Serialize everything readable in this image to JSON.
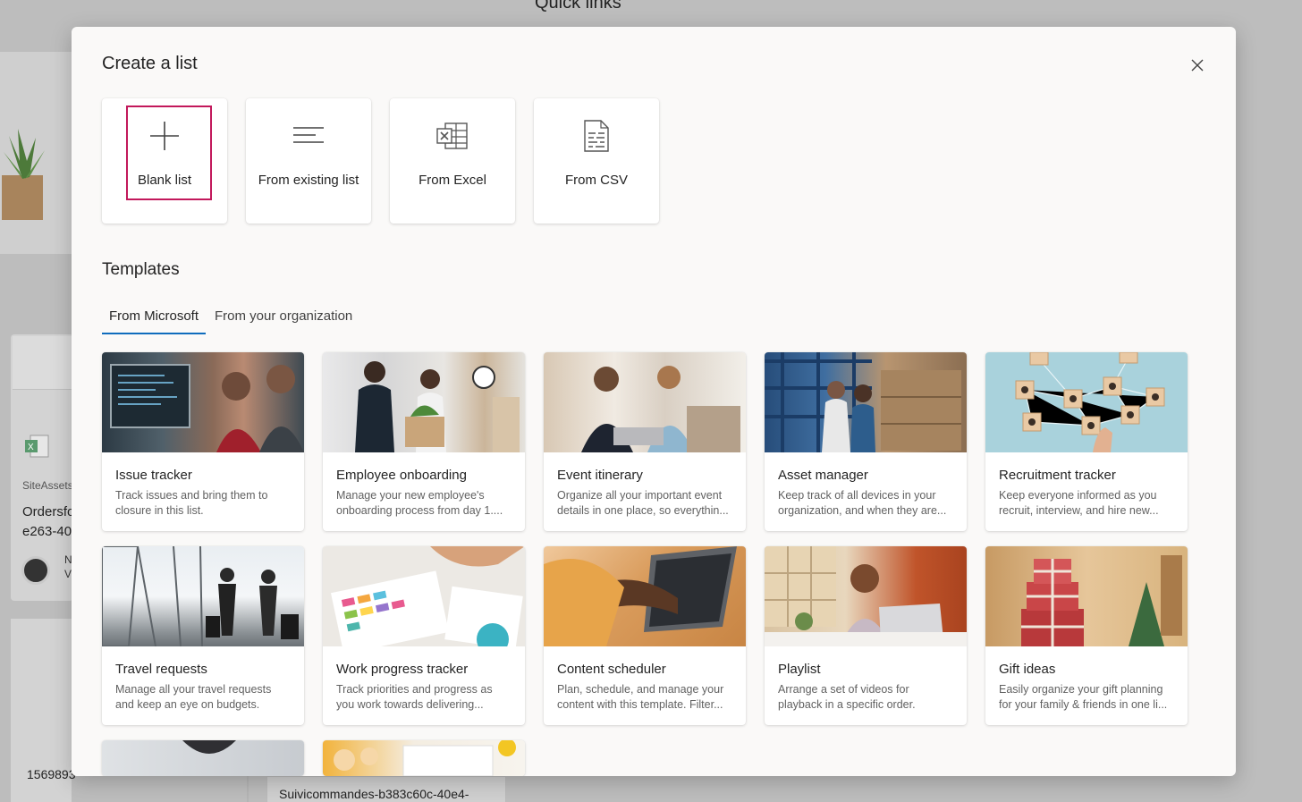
{
  "background": {
    "page_title": "Quick links",
    "site_label": "SiteAssets",
    "file_name_line1": "Ordersfo",
    "file_name_line2": "e263-40",
    "author_initials_1": "N",
    "author_initials_2": "V",
    "number": "1569893",
    "file_name_bottom": "Suivicommandes-b383c60c-40e4-"
  },
  "dialog": {
    "title": "Create a list",
    "close_icon": "close-icon",
    "create_options": [
      {
        "label": "Blank list",
        "icon": "plus-icon",
        "selected": true
      },
      {
        "label": "From existing list",
        "icon": "lines-icon"
      },
      {
        "label": "From Excel",
        "icon": "excel-icon"
      },
      {
        "label": "From CSV",
        "icon": "csv-file-icon"
      }
    ],
    "templates_heading": "Templates",
    "tabs": [
      {
        "label": "From Microsoft",
        "active": true
      },
      {
        "label": "From your organization",
        "active": false
      }
    ],
    "templates": [
      {
        "title": "Issue tracker",
        "desc": "Track issues and bring them to closure in this list."
      },
      {
        "title": "Employee onboarding",
        "desc": "Manage your new employee's onboarding process from day 1...."
      },
      {
        "title": "Event itinerary",
        "desc": "Organize all your important event details in one place, so everythin..."
      },
      {
        "title": "Asset manager",
        "desc": "Keep track of all devices in your organization, and when they are..."
      },
      {
        "title": "Recruitment tracker",
        "desc": "Keep everyone informed as you recruit, interview, and hire new..."
      },
      {
        "title": "Travel requests",
        "desc": "Manage all your travel requests and keep an eye on budgets."
      },
      {
        "title": "Work progress tracker",
        "desc": "Track priorities and progress as you work towards delivering..."
      },
      {
        "title": "Content scheduler",
        "desc": "Plan, schedule, and manage your content with this template. Filter..."
      },
      {
        "title": "Playlist",
        "desc": "Arrange a set of videos for playback in a specific order."
      },
      {
        "title": "Gift ideas",
        "desc": "Easily organize your gift planning for your family & friends in one li..."
      }
    ]
  },
  "colors": {
    "selection_highlight": "#c2185b",
    "tab_underline": "#0f6cbd",
    "excel_green": "#107c41"
  }
}
